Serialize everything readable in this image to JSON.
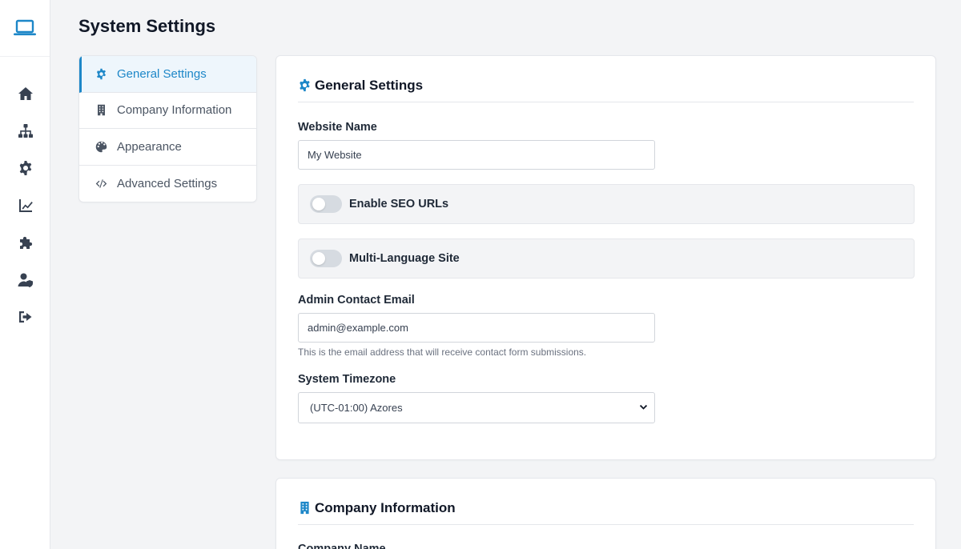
{
  "page": {
    "title": "System Settings"
  },
  "rail": {
    "logo_icon": "laptop-icon",
    "items": [
      {
        "icon": "home-icon"
      },
      {
        "icon": "sitemap-icon"
      },
      {
        "icon": "gear-icon"
      },
      {
        "icon": "chart-line-icon"
      },
      {
        "icon": "puzzle-icon"
      },
      {
        "icon": "user-shield-icon"
      },
      {
        "icon": "sign-out-icon"
      }
    ]
  },
  "submenu": {
    "items": [
      {
        "label": "General Settings",
        "icon": "gear-icon",
        "active": true
      },
      {
        "label": "Company Information",
        "icon": "building-icon",
        "active": false
      },
      {
        "label": "Appearance",
        "icon": "palette-icon",
        "active": false
      },
      {
        "label": "Advanced Settings",
        "icon": "code-icon",
        "active": false
      }
    ]
  },
  "general": {
    "title": "General Settings",
    "website_name_label": "Website Name",
    "website_name_value": "My Website",
    "seo_toggle_label": "Enable SEO URLs",
    "seo_enabled": false,
    "multilang_toggle_label": "Multi-Language Site",
    "multilang_enabled": false,
    "admin_email_label": "Admin Contact Email",
    "admin_email_value": "admin@example.com",
    "admin_email_help": "This is the email address that will receive contact form submissions.",
    "timezone_label": "System Timezone",
    "timezone_value": "(UTC-01:00) Azores"
  },
  "company": {
    "title": "Company Information",
    "company_name_label": "Company Name"
  },
  "colors": {
    "accent": "#1d87c8",
    "background": "#f3f4f6",
    "toggle_off": "#d6dbe1"
  }
}
